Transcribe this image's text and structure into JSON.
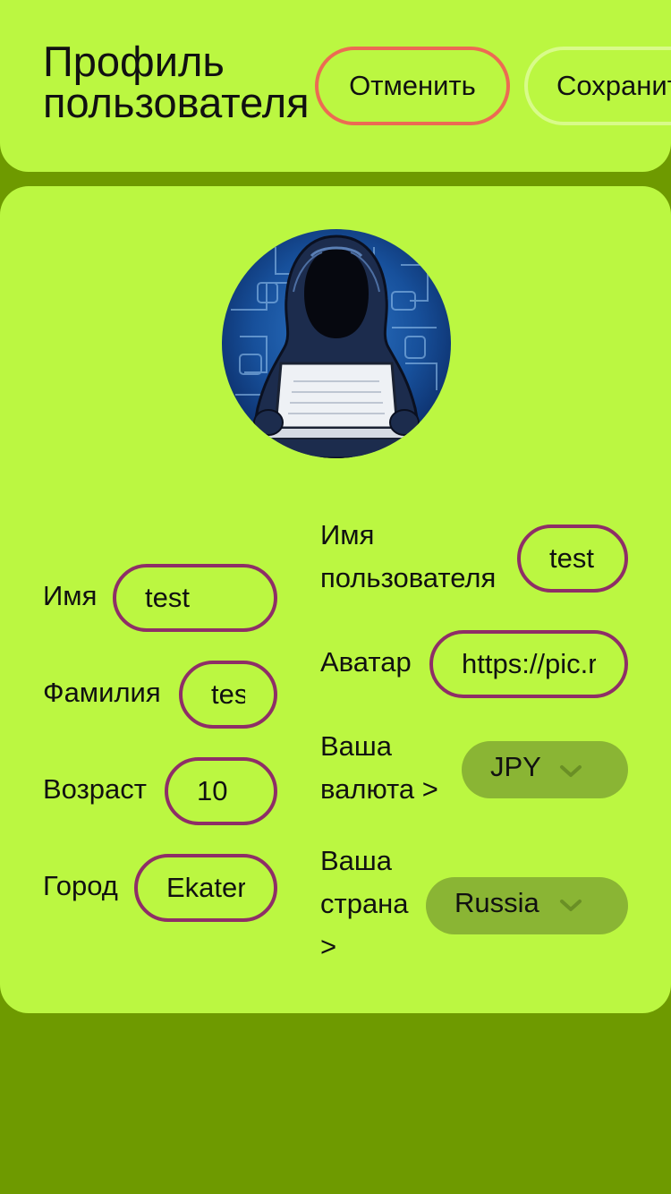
{
  "header": {
    "title_line1": "Профиль",
    "title_line2": "пользователя",
    "cancel_label": "Отменить",
    "save_label": "Сохранить"
  },
  "profile": {
    "first_name": {
      "label": "Имя",
      "value": "test"
    },
    "last_name": {
      "label": "Фамилия",
      "value": "test"
    },
    "age": {
      "label": "Возраст",
      "value": "10"
    },
    "city": {
      "label": "Город",
      "value": "Ekaterinburg"
    },
    "username": {
      "label_line1": "Имя",
      "label_line2": "пользователя",
      "value": "test"
    },
    "avatar": {
      "label": "Аватар",
      "value": "https://pic.r"
    },
    "currency": {
      "label_line1": "Ваша",
      "label_line2": "валюта >",
      "value": "JPY"
    },
    "country": {
      "label_line1": "Ваша",
      "label_line2": "страна",
      "label_line3": ">",
      "value": "Russia"
    }
  },
  "icons": {
    "avatar_image": "hooded-hacker-laptop-avatar",
    "select_arrow": "chevron-down-icon"
  },
  "colors": {
    "page_background": "#6e9a00",
    "card_background": "#bbf741",
    "cancel_border": "#ec6b53",
    "save_border": "#d8fb8a",
    "input_border": "#8e2e67",
    "select_background": "#8ab534"
  }
}
